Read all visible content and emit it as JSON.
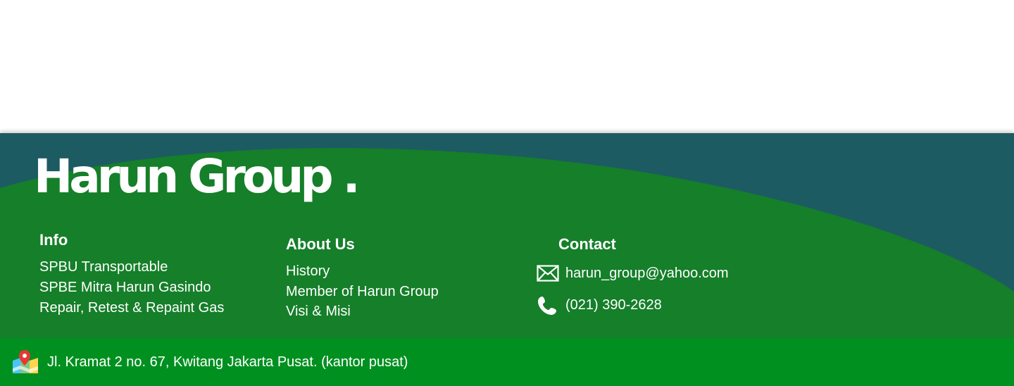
{
  "footer": {
    "logo_text": "Harun Group",
    "logo_dot": ".",
    "info": {
      "title": "Info",
      "links": [
        "SPBU Transportable",
        "SPBE Mitra Harun Gasindo",
        "Repair, Retest & Repaint Gas"
      ]
    },
    "about": {
      "title": "About Us",
      "links": [
        "History",
        "Member of Harun Group",
        "Visi & Misi"
      ]
    },
    "contact": {
      "title": "Contact",
      "email": "harun_group@yahoo.com",
      "phone": "(021) 390-2628"
    },
    "address": "Jl. Kramat 2 no. 67, Kwitang Jakarta Pusat. (kantor pusat)"
  },
  "icons": {
    "email": "envelope-icon",
    "phone": "phone-icon",
    "address": "map-pin-icon"
  },
  "colors": {
    "footer_dark": "#1d5b63",
    "footer_green": "#157f29",
    "address_bar": "#009020",
    "text": "#ffffff"
  }
}
